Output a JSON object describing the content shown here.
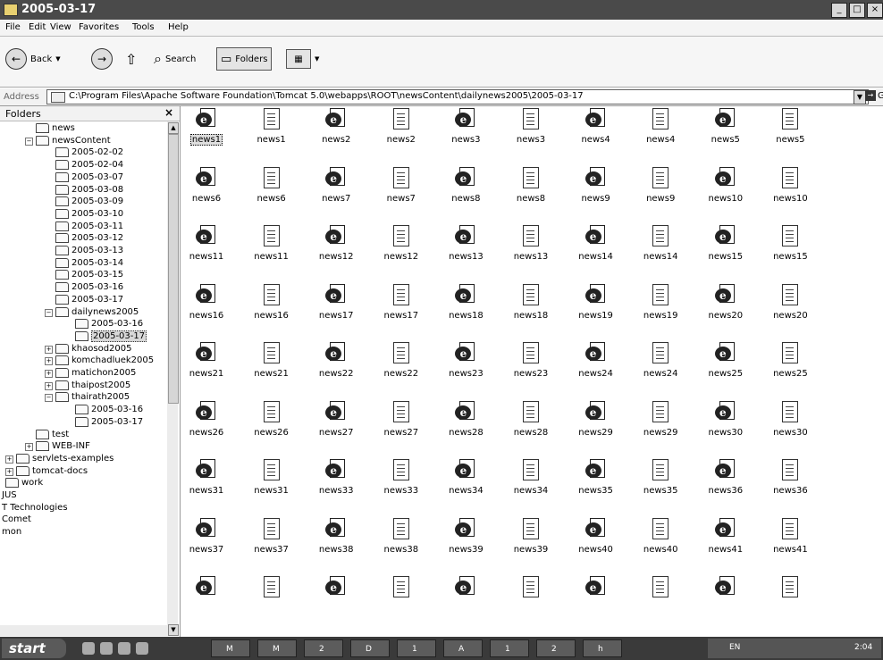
{
  "window": {
    "title": "2005-03-17"
  },
  "menu": [
    "File",
    "Edit",
    "View",
    "Favorites",
    "Tools",
    "Help"
  ],
  "toolbar": {
    "back": "Back",
    "search": "Search",
    "folders": "Folders"
  },
  "address": {
    "label": "Address",
    "path": "C:\\Program Files\\Apache Software Foundation\\Tomcat 5.0\\webapps\\ROOT\\newsContent\\dailynews2005\\2005-03-17",
    "go": "Go"
  },
  "folders_pane": {
    "title": "Folders",
    "close": "×",
    "items": [
      {
        "label": "news",
        "indent": 1,
        "expander": ""
      },
      {
        "label": "newsContent",
        "indent": 1,
        "expander": "−"
      },
      {
        "label": "2005-02-02",
        "indent": 2,
        "expander": ""
      },
      {
        "label": "2005-02-04",
        "indent": 2,
        "expander": ""
      },
      {
        "label": "2005-03-07",
        "indent": 2,
        "expander": ""
      },
      {
        "label": "2005-03-08",
        "indent": 2,
        "expander": ""
      },
      {
        "label": "2005-03-09",
        "indent": 2,
        "expander": ""
      },
      {
        "label": "2005-03-10",
        "indent": 2,
        "expander": ""
      },
      {
        "label": "2005-03-11",
        "indent": 2,
        "expander": ""
      },
      {
        "label": "2005-03-12",
        "indent": 2,
        "expander": ""
      },
      {
        "label": "2005-03-13",
        "indent": 2,
        "expander": ""
      },
      {
        "label": "2005-03-14",
        "indent": 2,
        "expander": ""
      },
      {
        "label": "2005-03-15",
        "indent": 2,
        "expander": ""
      },
      {
        "label": "2005-03-16",
        "indent": 2,
        "expander": ""
      },
      {
        "label": "2005-03-17",
        "indent": 2,
        "expander": ""
      },
      {
        "label": "dailynews2005",
        "indent": 2,
        "expander": "−"
      },
      {
        "label": "2005-03-16",
        "indent": 3,
        "expander": ""
      },
      {
        "label": "2005-03-17",
        "indent": 3,
        "expander": "",
        "selected": true
      },
      {
        "label": "khaosod2005",
        "indent": 2,
        "expander": "+"
      },
      {
        "label": "komchadluek2005",
        "indent": 2,
        "expander": "+"
      },
      {
        "label": "matichon2005",
        "indent": 2,
        "expander": "+"
      },
      {
        "label": "thaipost2005",
        "indent": 2,
        "expander": "+"
      },
      {
        "label": "thairath2005",
        "indent": 2,
        "expander": "−"
      },
      {
        "label": "2005-03-16",
        "indent": 3,
        "expander": ""
      },
      {
        "label": "2005-03-17",
        "indent": 3,
        "expander": ""
      },
      {
        "label": "test",
        "indent": 1,
        "expander": ""
      },
      {
        "label": "WEB-INF",
        "indent": 1,
        "expander": "+"
      },
      {
        "label": "servlets-examples",
        "indent": 0,
        "expander": "+"
      },
      {
        "label": "tomcat-docs",
        "indent": 0,
        "expander": "+"
      },
      {
        "label": "work",
        "indent": -1,
        "expander": ""
      },
      {
        "label": "JUS",
        "indent": -2,
        "expander": "",
        "plain": true
      },
      {
        "label": "T Technologies",
        "indent": -2,
        "expander": "",
        "plain": true
      },
      {
        "label": "Comet",
        "indent": -2,
        "expander": "",
        "plain": true
      },
      {
        "label": "mon",
        "indent": -2,
        "expander": "",
        "plain": true
      }
    ]
  },
  "files": [
    {
      "name": "news1",
      "type": "ie",
      "selected": true
    },
    {
      "name": "news1",
      "type": "txt"
    },
    {
      "name": "news2",
      "type": "ie"
    },
    {
      "name": "news2",
      "type": "txt"
    },
    {
      "name": "news3",
      "type": "ie"
    },
    {
      "name": "news3",
      "type": "txt"
    },
    {
      "name": "news4",
      "type": "ie"
    },
    {
      "name": "news4",
      "type": "txt"
    },
    {
      "name": "news5",
      "type": "ie"
    },
    {
      "name": "news5",
      "type": "txt"
    },
    {
      "name": "news6",
      "type": "ie"
    },
    {
      "name": "news6",
      "type": "txt"
    },
    {
      "name": "news7",
      "type": "ie"
    },
    {
      "name": "news7",
      "type": "txt"
    },
    {
      "name": "news8",
      "type": "ie"
    },
    {
      "name": "news8",
      "type": "txt"
    },
    {
      "name": "news9",
      "type": "ie"
    },
    {
      "name": "news9",
      "type": "txt"
    },
    {
      "name": "news10",
      "type": "ie"
    },
    {
      "name": "news10",
      "type": "txt"
    },
    {
      "name": "news11",
      "type": "ie"
    },
    {
      "name": "news11",
      "type": "txt"
    },
    {
      "name": "news12",
      "type": "ie"
    },
    {
      "name": "news12",
      "type": "txt"
    },
    {
      "name": "news13",
      "type": "ie"
    },
    {
      "name": "news13",
      "type": "txt"
    },
    {
      "name": "news14",
      "type": "ie"
    },
    {
      "name": "news14",
      "type": "txt"
    },
    {
      "name": "news15",
      "type": "ie"
    },
    {
      "name": "news15",
      "type": "txt"
    },
    {
      "name": "news16",
      "type": "ie"
    },
    {
      "name": "news16",
      "type": "txt"
    },
    {
      "name": "news17",
      "type": "ie"
    },
    {
      "name": "news17",
      "type": "txt"
    },
    {
      "name": "news18",
      "type": "ie"
    },
    {
      "name": "news18",
      "type": "txt"
    },
    {
      "name": "news19",
      "type": "ie"
    },
    {
      "name": "news19",
      "type": "txt"
    },
    {
      "name": "news20",
      "type": "ie"
    },
    {
      "name": "news20",
      "type": "txt"
    },
    {
      "name": "news21",
      "type": "ie"
    },
    {
      "name": "news21",
      "type": "txt"
    },
    {
      "name": "news22",
      "type": "ie"
    },
    {
      "name": "news22",
      "type": "txt"
    },
    {
      "name": "news23",
      "type": "ie"
    },
    {
      "name": "news23",
      "type": "txt"
    },
    {
      "name": "news24",
      "type": "ie"
    },
    {
      "name": "news24",
      "type": "txt"
    },
    {
      "name": "news25",
      "type": "ie"
    },
    {
      "name": "news25",
      "type": "txt"
    },
    {
      "name": "news26",
      "type": "ie"
    },
    {
      "name": "news26",
      "type": "txt"
    },
    {
      "name": "news27",
      "type": "ie"
    },
    {
      "name": "news27",
      "type": "txt"
    },
    {
      "name": "news28",
      "type": "ie"
    },
    {
      "name": "news28",
      "type": "txt"
    },
    {
      "name": "news29",
      "type": "ie"
    },
    {
      "name": "news29",
      "type": "txt"
    },
    {
      "name": "news30",
      "type": "ie"
    },
    {
      "name": "news30",
      "type": "txt"
    },
    {
      "name": "news31",
      "type": "ie"
    },
    {
      "name": "news31",
      "type": "txt"
    },
    {
      "name": "news33",
      "type": "ie"
    },
    {
      "name": "news33",
      "type": "txt"
    },
    {
      "name": "news34",
      "type": "ie"
    },
    {
      "name": "news34",
      "type": "txt"
    },
    {
      "name": "news35",
      "type": "ie"
    },
    {
      "name": "news35",
      "type": "txt"
    },
    {
      "name": "news36",
      "type": "ie"
    },
    {
      "name": "news36",
      "type": "txt"
    },
    {
      "name": "news37",
      "type": "ie"
    },
    {
      "name": "news37",
      "type": "txt"
    },
    {
      "name": "news38",
      "type": "ie"
    },
    {
      "name": "news38",
      "type": "txt"
    },
    {
      "name": "news39",
      "type": "ie"
    },
    {
      "name": "news39",
      "type": "txt"
    },
    {
      "name": "news40",
      "type": "ie"
    },
    {
      "name": "news40",
      "type": "txt"
    },
    {
      "name": "news41",
      "type": "ie"
    },
    {
      "name": "news41",
      "type": "txt"
    },
    {
      "name": "",
      "type": "ie"
    },
    {
      "name": "",
      "type": "txt"
    },
    {
      "name": "",
      "type": "ie"
    },
    {
      "name": "",
      "type": "txt"
    },
    {
      "name": "",
      "type": "ie"
    },
    {
      "name": "",
      "type": "txt"
    },
    {
      "name": "",
      "type": "ie"
    },
    {
      "name": "",
      "type": "txt"
    },
    {
      "name": "",
      "type": "ie"
    },
    {
      "name": "",
      "type": "txt"
    }
  ],
  "taskbar": {
    "start": "start",
    "tasks": [
      "M",
      "M",
      "2",
      "D",
      "1",
      "A",
      "1",
      "2",
      "h"
    ],
    "lang": "EN",
    "clock": "2:04"
  }
}
